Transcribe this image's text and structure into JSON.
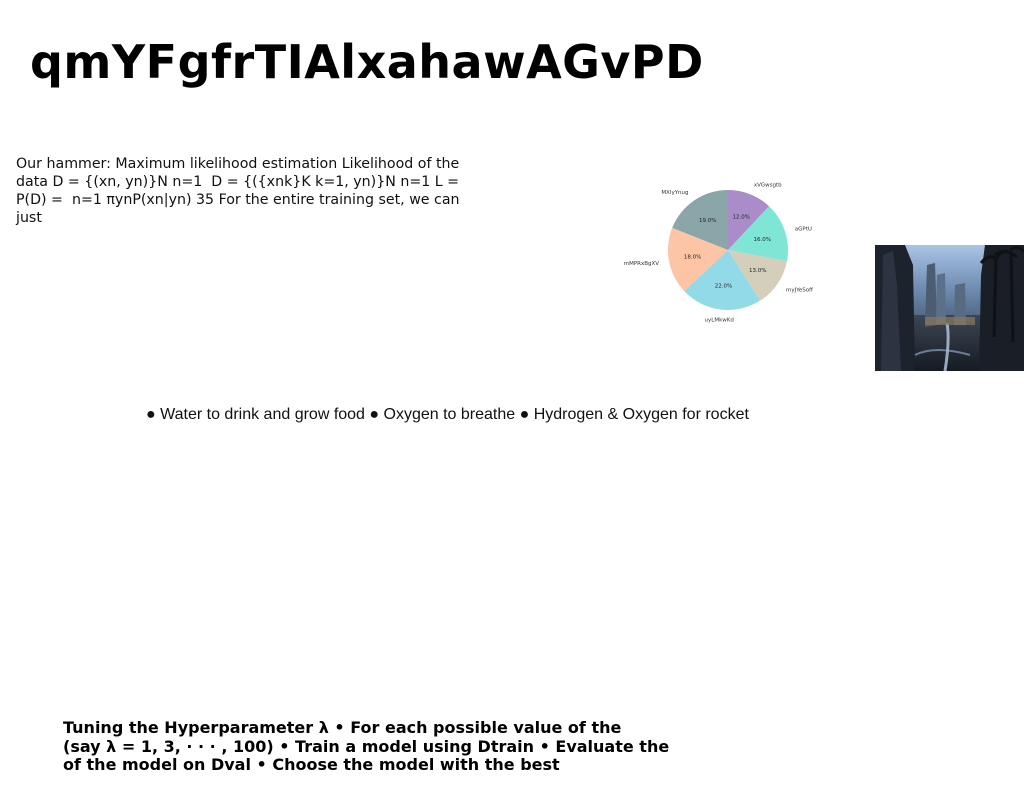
{
  "page": {
    "title": "qmYFgfrTIAlxahawAGvPD",
    "paragraph": "Our hammer: Maximum likelihood estimation Likelihood of the data D = {(xn, yn)}N n=1 \u001e D = {({xnk}K k=1, yn)}N n=1 L = P(D) = \u001e n=1 πynP(xn|yn) 35 For the entire training set, we can just",
    "bullets": "● Water to drink and grow food ● Oxygen to breathe ● Hydrogen & Oxygen for rocket",
    "bottom_lines": [
      "Tuning the Hyperparameter λ • For each possible value of the",
      "(say λ = 1, 3, · · · , 100) • Train a model using Dtrain • Evaluate the",
      "of the model on Dval • Choose the model with the best"
    ]
  },
  "chart_data": {
    "type": "pie",
    "slices": [
      {
        "label": "xVGwsgtb",
        "value": 12.0,
        "display": "12.0%",
        "color": "#a98cc8"
      },
      {
        "label": "aGPtU",
        "value": 16.0,
        "display": "16.0%",
        "color": "#7fe6d6"
      },
      {
        "label": "myJYeSoff",
        "value": 13.0,
        "display": "13.0%",
        "color": "#d4ceba"
      },
      {
        "label": "uyLMkwKd",
        "value": 22.0,
        "display": "22.0%",
        "color": "#92dae8"
      },
      {
        "label": "mMPRxBgXV",
        "value": 18.0,
        "display": "18.0%",
        "color": "#fdc4a6"
      },
      {
        "label": "MXIyYnug",
        "value": 19.0,
        "display": "19.0%",
        "color": "#8aa6a8"
      }
    ],
    "start_angle": 90,
    "direction": "clockwise"
  }
}
